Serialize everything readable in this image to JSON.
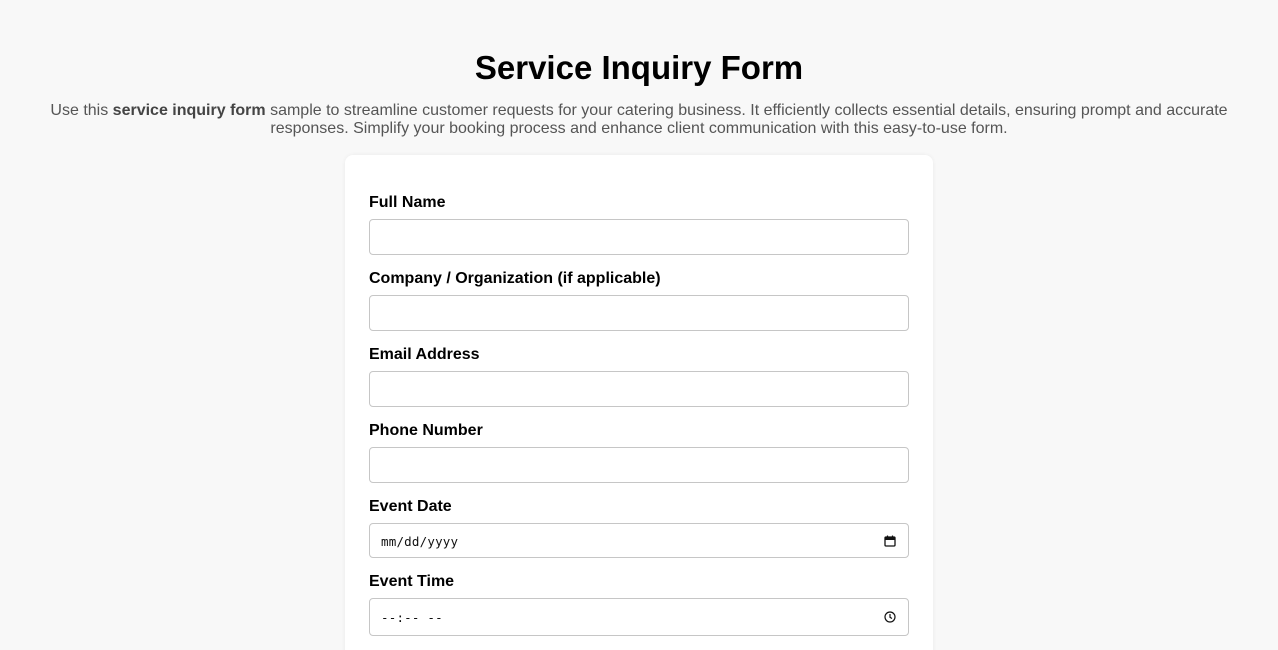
{
  "page": {
    "title": "Service Inquiry Form",
    "intro_pre": "Use this ",
    "intro_bold": "service inquiry form",
    "intro_post": " sample to streamline customer requests for your catering business. It efficiently collects essential details, ensuring prompt and accurate responses. Simplify your booking process and enhance client communication with this easy-to-use form."
  },
  "form": {
    "fields": [
      {
        "label": "Full Name",
        "value": ""
      },
      {
        "label": "Company / Organization (if applicable)",
        "value": ""
      },
      {
        "label": "Email Address",
        "value": ""
      },
      {
        "label": "Phone Number",
        "value": ""
      },
      {
        "label": "Event Date",
        "display": "mm/dd/yyyy",
        "icon": "calendar-icon"
      },
      {
        "label": "Event Time",
        "display": "--:-- --",
        "icon": "clock-icon"
      }
    ]
  }
}
